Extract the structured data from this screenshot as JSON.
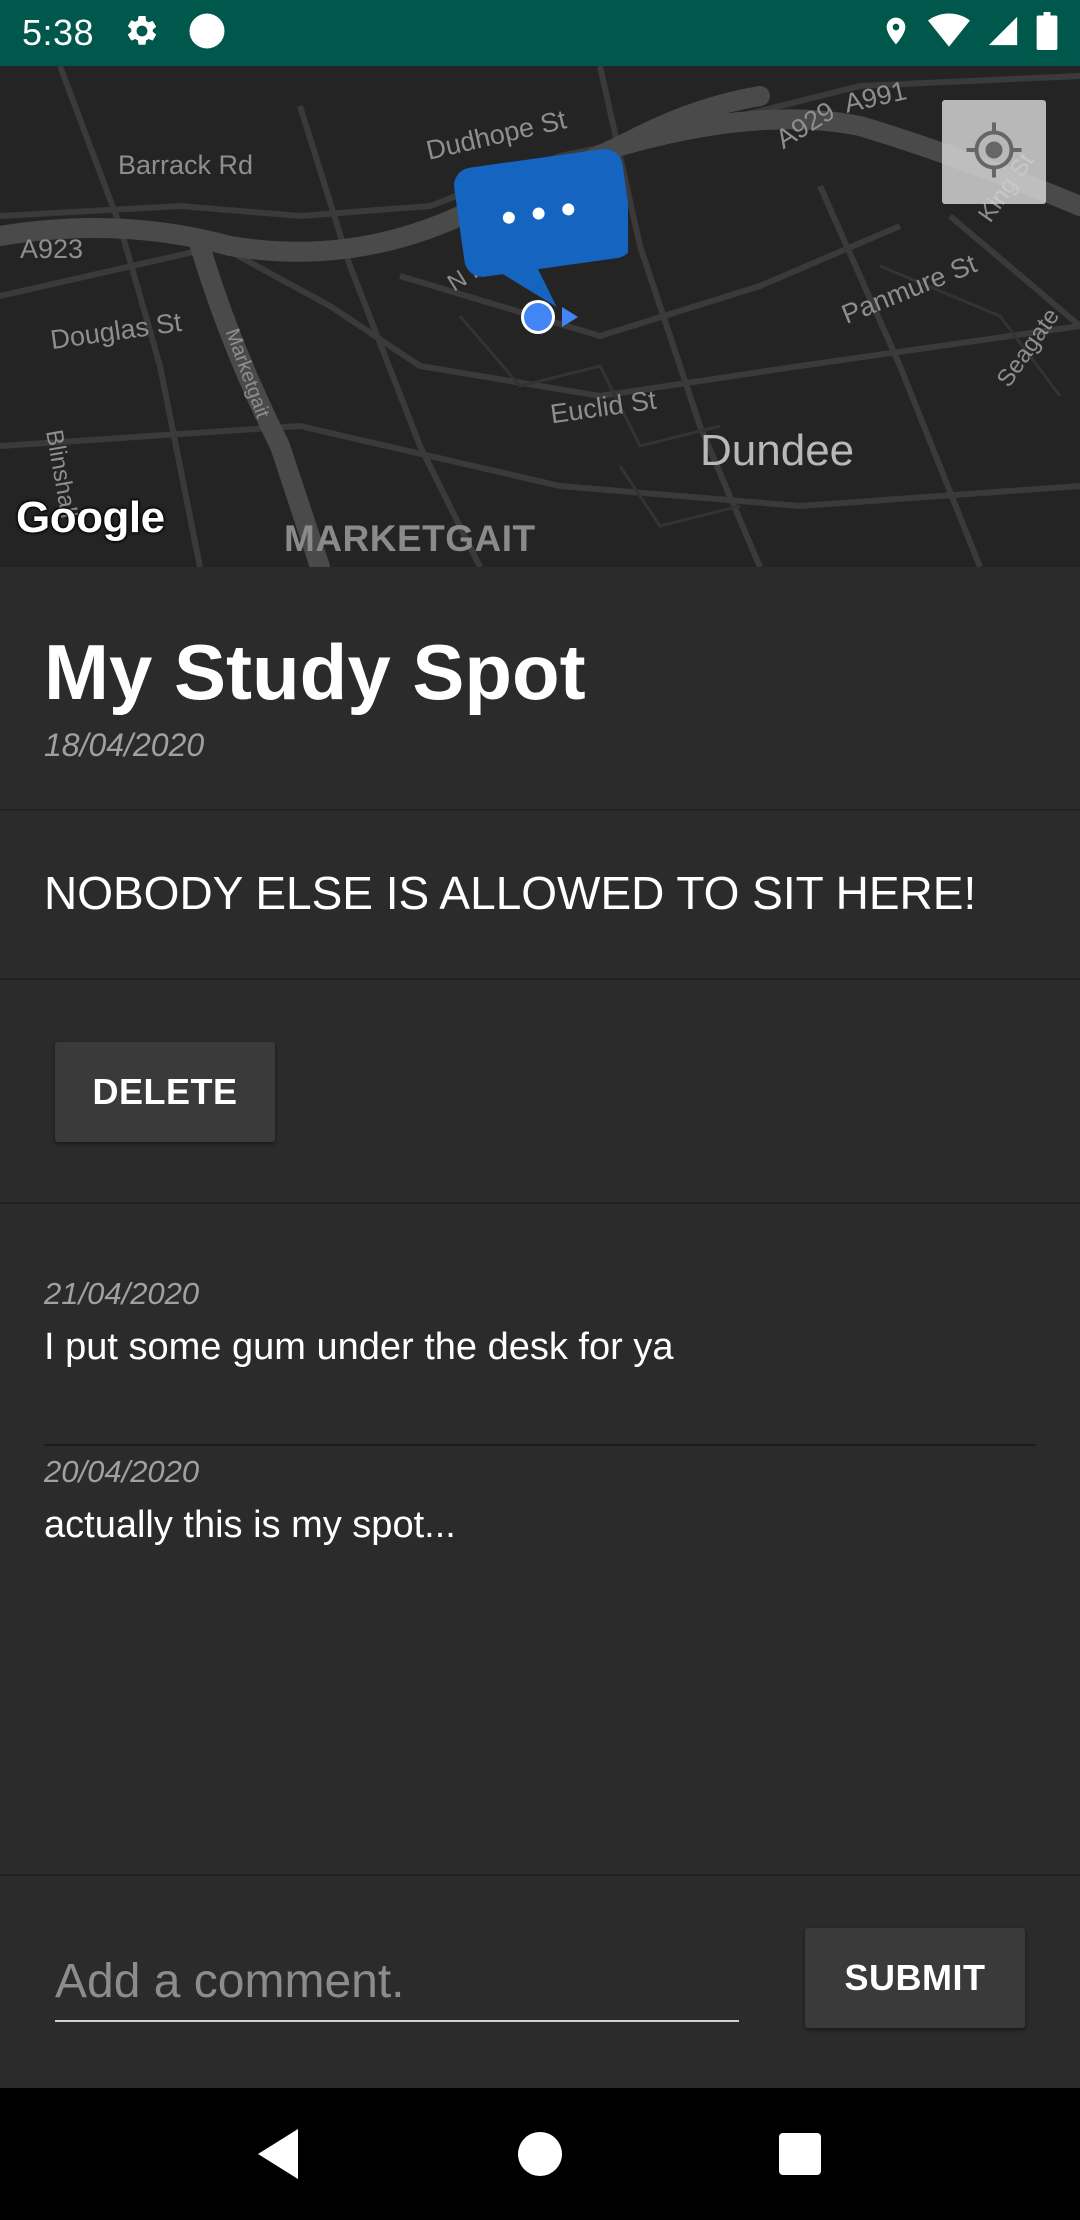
{
  "status_bar": {
    "time": "5:38",
    "icons": [
      "gear-icon",
      "circle-icon",
      "location-icon",
      "wifi-icon",
      "signal-icon",
      "battery-icon"
    ],
    "background": "#00574b"
  },
  "map": {
    "labels": {
      "dudhope": "Dudhope St",
      "barrack": "Barrack Rd",
      "a929": "A929",
      "a991": "A991",
      "a923": "A923",
      "douglas": "Douglas St",
      "marketgait_v": "Marketgait",
      "n_marketgait": "N Marketgait",
      "panmure": "Panmure St",
      "king": "King St",
      "seagate": "Seagate",
      "euclid": "Euclid St",
      "blinshall": "Blinshall",
      "dundee": "Dundee",
      "marketgait_bold": "MARKETGAIT"
    },
    "google": "Google",
    "marker_text": "• • •",
    "marker_color": "#1565c0",
    "location_dot_color": "#4285f4"
  },
  "spot": {
    "title": "My Study Spot",
    "date": "18/04/2020",
    "description": "NOBODY ELSE IS ALLOWED TO SIT HERE!"
  },
  "actions": {
    "delete_label": "DELETE"
  },
  "comments": [
    {
      "date": "21/04/2020",
      "text": "I put some gum under the desk for ya"
    },
    {
      "date": "20/04/2020",
      "text": "actually this is my spot..."
    }
  ],
  "comment_form": {
    "placeholder": "Add a comment.",
    "value": "",
    "submit_label": "SUBMIT"
  },
  "nav_bar": {
    "icons": [
      "back-icon",
      "home-icon",
      "recents-icon"
    ]
  }
}
